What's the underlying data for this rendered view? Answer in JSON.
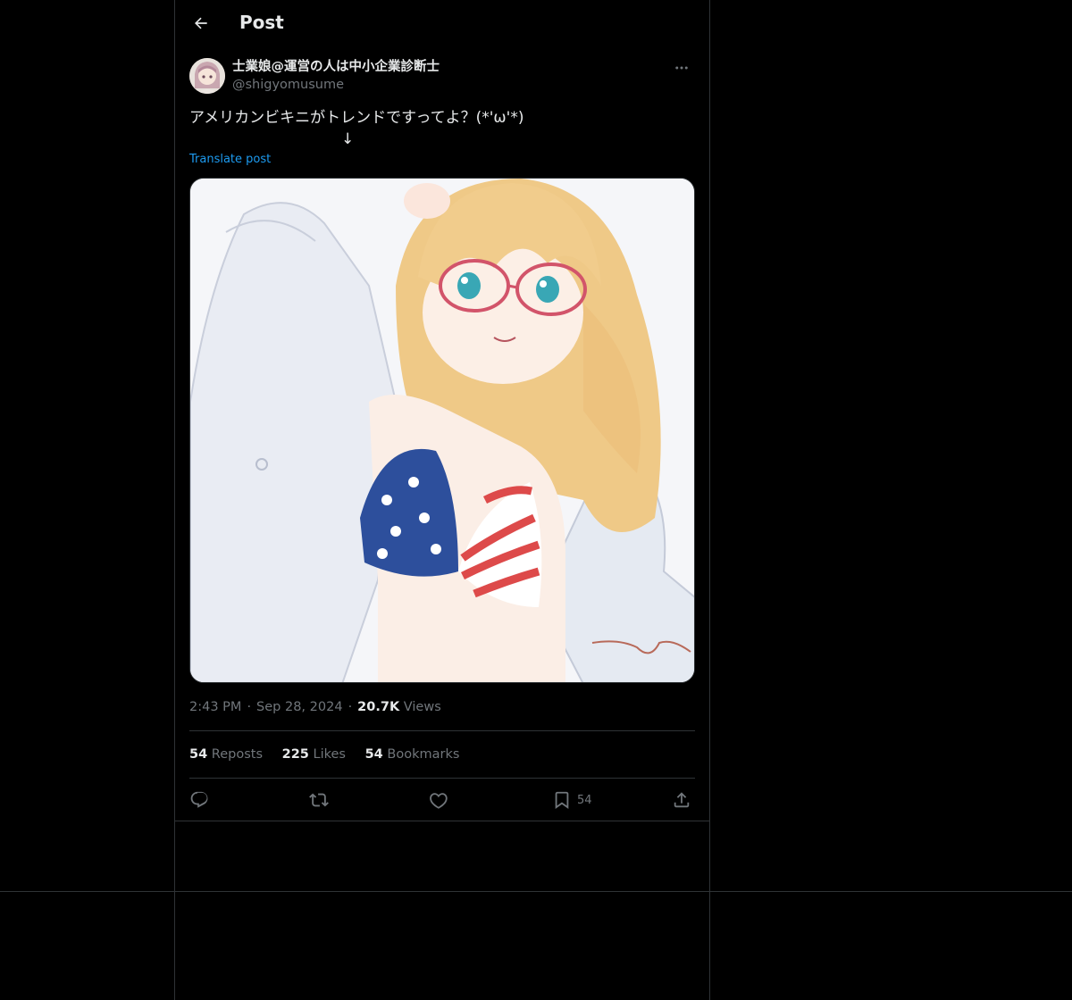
{
  "header": {
    "title": "Post"
  },
  "author": {
    "display_name": "士業娘@運営の人は中小企業診断士",
    "handle": "@shigyomusume"
  },
  "post": {
    "text_line1": "アメリカンビキニがトレンドですってよ？(*'ω'*)",
    "text_line2": "↓",
    "translate_label": "Translate post"
  },
  "meta": {
    "time": "2:43 PM",
    "date": "Sep 28, 2024",
    "views_count": "20.7K",
    "views_label": "Views"
  },
  "stats": {
    "reposts_count": "54",
    "reposts_label": "Reposts",
    "likes_count": "225",
    "likes_label": "Likes",
    "bookmarks_count": "54",
    "bookmarks_label": "Bookmarks"
  },
  "actions": {
    "bookmark_count": "54"
  },
  "colors": {
    "background": "#000000",
    "divider": "#2f3336",
    "link": "#1d9bf0",
    "muted": "#71767b",
    "text": "#e7e9ea"
  },
  "icons": [
    "back-arrow-icon",
    "more-icon",
    "reply-icon",
    "repost-icon",
    "like-icon",
    "bookmark-icon",
    "share-icon"
  ]
}
